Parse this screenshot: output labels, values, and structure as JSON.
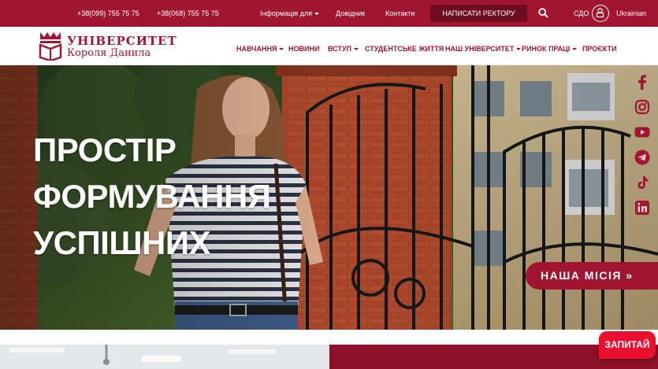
{
  "topbar": {
    "phone1": "+38(099) 755 75 75",
    "phone2": "+38(068) 755 75 75",
    "info_for": "Інформація для",
    "directory": "Довідник",
    "contacts": "Контакти",
    "write_rector": "Написати ректору",
    "sdo": "СДО",
    "language": "Ukrainian"
  },
  "logo": {
    "line1": "УНІВЕРСИТЕТ",
    "line2": "Короля Данила"
  },
  "nav": {
    "items": [
      {
        "label": "Навчання",
        "dropdown": true
      },
      {
        "label": "Новини",
        "dropdown": false
      },
      {
        "label": "Вступ",
        "dropdown": true
      },
      {
        "label": "Студентське життя",
        "dropdown": false
      },
      {
        "label": "Наш університет",
        "dropdown": true
      },
      {
        "label": "Ринок праці",
        "dropdown": true
      },
      {
        "label": "Проєкти",
        "dropdown": false
      }
    ]
  },
  "hero": {
    "title_lines": [
      "ПРОСТІР",
      "ФОРМУВАННЯ",
      "УСПІШНИХ"
    ],
    "mission_button": "НАША МІСІЯ »"
  },
  "social": [
    "facebook-icon",
    "instagram-icon",
    "youtube-icon",
    "telegram-icon",
    "tiktok-icon",
    "linkedin-icon"
  ],
  "ask_button": "ЗАПИТАЙ",
  "colors": {
    "brand": "#a01530",
    "brand_dark": "#6e0d20",
    "ask": "#e8102e"
  }
}
